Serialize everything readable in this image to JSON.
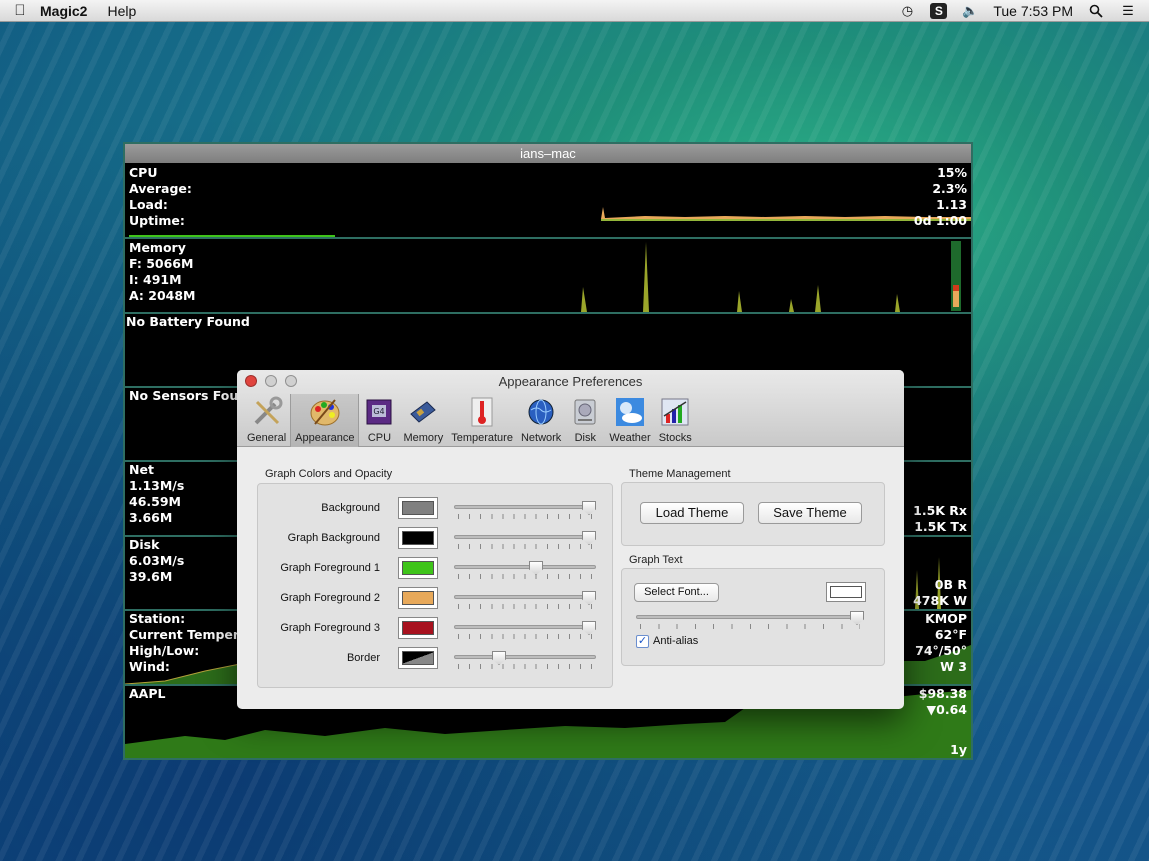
{
  "menubar": {
    "app_name": "Magic2",
    "menus": [
      "Help"
    ],
    "clock": "Tue 7:53 PM",
    "icons": [
      "apple-icon",
      "time-machine-icon",
      "s-app-icon",
      "volume-icon",
      "spotlight-icon",
      "notification-list-icon"
    ]
  },
  "monitor": {
    "title": "ians–mac",
    "cpu": {
      "labels": [
        "CPU",
        "Average:",
        "Load:",
        "Uptime:"
      ],
      "values": [
        "15%",
        "2.3%",
        "1.13",
        "0d 1:00"
      ]
    },
    "memory": {
      "labels": [
        "Memory",
        "F: 5066M",
        "I: 491M",
        "A: 2048M"
      ]
    },
    "battery": {
      "label": "No Battery Found"
    },
    "sensors": {
      "label": "No Sensors Found"
    },
    "net": {
      "labels": [
        "Net",
        "1.13M/s",
        "46.59M",
        "3.66M"
      ],
      "values": [
        "1.5K Rx",
        "1.5K Tx"
      ]
    },
    "disk": {
      "labels": [
        "Disk",
        "6.03M/s",
        "39.6M"
      ],
      "values": [
        "0B R",
        "478K W"
      ]
    },
    "weather": {
      "labels": [
        "Station:",
        "Current Temperatu",
        "High/Low:",
        "Wind:"
      ],
      "values": [
        "KMOP",
        "62°F",
        "74°/50°",
        "W 3"
      ]
    },
    "stocks": {
      "label": "AAPL",
      "values": [
        "$98.38",
        "▼0.64",
        "1y"
      ]
    }
  },
  "prefs": {
    "title": "Appearance Preferences",
    "toolbar": [
      {
        "label": "General",
        "icon": "tools-icon"
      },
      {
        "label": "Appearance",
        "icon": "palette-icon"
      },
      {
        "label": "CPU",
        "icon": "cpu-chip-icon"
      },
      {
        "label": "Memory",
        "icon": "memory-stick-icon"
      },
      {
        "label": "Temperature",
        "icon": "thermometer-icon"
      },
      {
        "label": "Network",
        "icon": "globe-icon"
      },
      {
        "label": "Disk",
        "icon": "disk-drive-icon"
      },
      {
        "label": "Weather",
        "icon": "weather-sky-icon"
      },
      {
        "label": "Stocks",
        "icon": "stocks-chart-icon"
      }
    ],
    "selected_tab": "Appearance",
    "graph_colors": {
      "title": "Graph Colors and Opacity",
      "rows": [
        {
          "label": "Background",
          "color": "#808080",
          "opacity": 1.0
        },
        {
          "label": "Graph Background",
          "color": "#000000",
          "opacity": 1.0
        },
        {
          "label": "Graph Foreground 1",
          "color": "#3fc41a",
          "opacity": 0.58
        },
        {
          "label": "Graph Foreground 2",
          "color": "#e8a95a",
          "opacity": 1.0
        },
        {
          "label": "Graph Foreground 3",
          "color": "#a8121f",
          "opacity": 1.0
        },
        {
          "label": "Border",
          "color": "#000000",
          "opacity": 0.3
        }
      ]
    },
    "theme": {
      "title": "Theme Management",
      "load": "Load Theme",
      "save": "Save Theme"
    },
    "graph_text": {
      "title": "Graph Text",
      "select_font": "Select Font...",
      "color": "#ffffff",
      "opacity": 1.0,
      "anti_alias_label": "Anti-alias",
      "anti_alias": true
    }
  }
}
